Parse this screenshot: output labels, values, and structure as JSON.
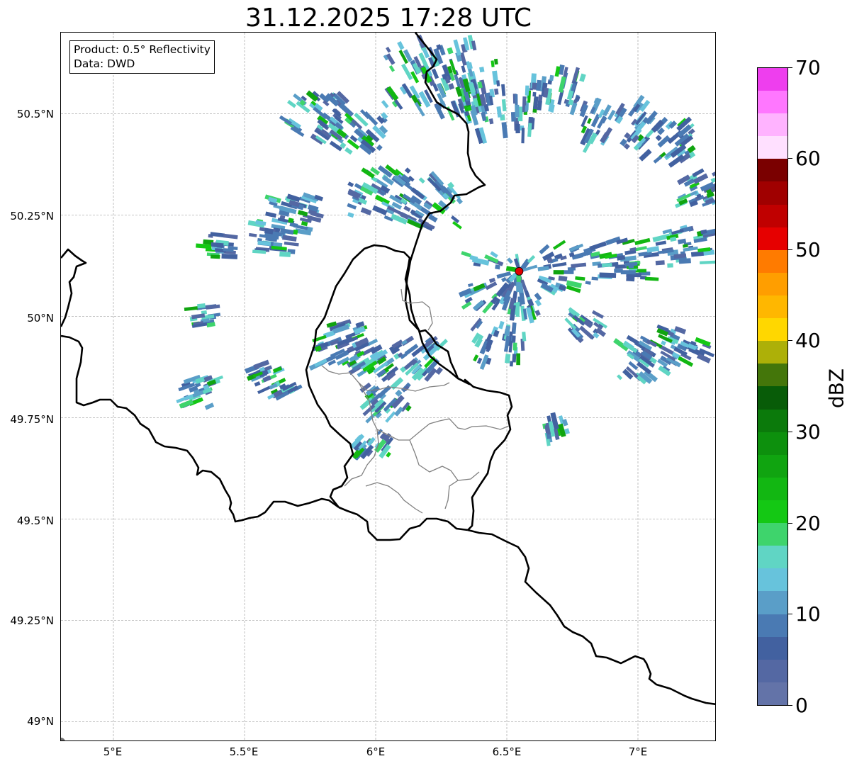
{
  "title": "31.12.2025 17:28 UTC",
  "info": {
    "product": "Product: 0.5° Reflectivity",
    "data": "Data: DWD"
  },
  "axes": {
    "lat_labels": [
      "50.5°N",
      "50.25°N",
      "50°N",
      "49.75°N",
      "49.5°N",
      "49.25°N",
      "49°N"
    ],
    "lon_labels": [
      "5°E",
      "5.5°E",
      "6°E",
      "6.5°E",
      "7°E"
    ]
  },
  "map": {
    "lon_range": [
      4.8,
      7.3
    ],
    "lat_range": [
      48.95,
      50.7
    ],
    "gridlines": true,
    "radar_site": {
      "lon": 6.547,
      "lat": 50.111,
      "color": "#e00000"
    },
    "border_color": "#000000",
    "canton_color": "#808080"
  },
  "colorbar": {
    "unit": "dBZ",
    "range": [
      0,
      70
    ],
    "tick_labels": [
      "0",
      "10",
      "20",
      "30",
      "40",
      "50",
      "60",
      "70"
    ],
    "colors": [
      "#6373a8",
      "#5468a3",
      "#4261a0",
      "#4a7ab3",
      "#5a9ec8",
      "#67c3dc",
      "#60d5c4",
      "#3ed46c",
      "#14c814",
      "#12b712",
      "#10a410",
      "#0d900d",
      "#0b7a0b",
      "#085c08",
      "#44760a",
      "#adb008",
      "#ffd700",
      "#ffb700",
      "#ff9e00",
      "#ff7b00",
      "#e60000",
      "#c00000",
      "#a00000",
      "#7a0000",
      "#ffe0ff",
      "#ffb3ff",
      "#ff77ff",
      "#ee3eee"
    ]
  }
}
